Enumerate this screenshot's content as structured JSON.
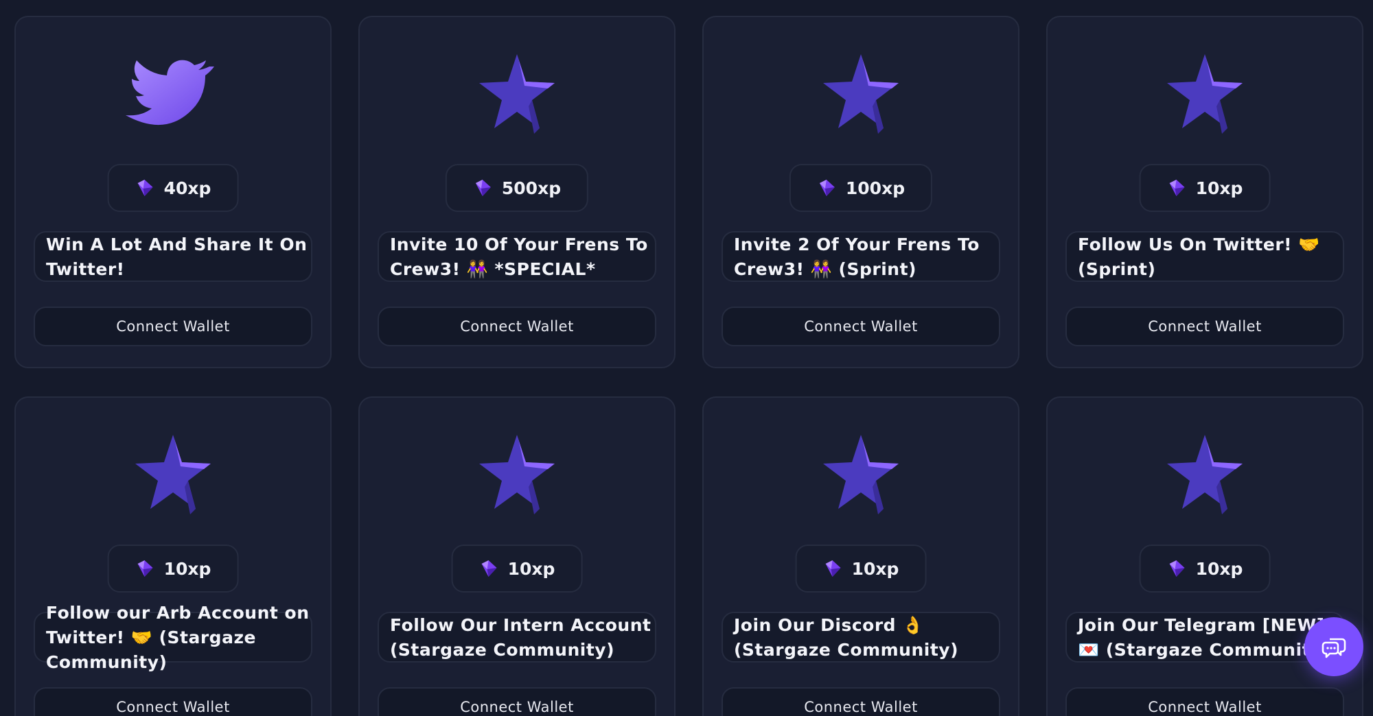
{
  "quests": [
    {
      "art": "twitter-bird",
      "xp": "40xp",
      "title": "Win A Lot And Share It On Twitter!",
      "button": "Connect Wallet"
    },
    {
      "art": "star",
      "xp": "500xp",
      "title": "Invite 10 Of Your Frens To Crew3! 👭 *SPECIAL*",
      "button": "Connect Wallet"
    },
    {
      "art": "star",
      "xp": "100xp",
      "title": "Invite 2 Of Your Frens To Crew3! 👭 (Sprint)",
      "button": "Connect Wallet"
    },
    {
      "art": "star",
      "xp": "10xp",
      "title": "Follow Us On Twitter! 🤝 (Sprint)",
      "button": "Connect Wallet"
    },
    {
      "art": "star",
      "xp": "10xp",
      "title": "Follow our Arb Account on Twitter! 🤝 (Stargaze Community)",
      "button": "Connect Wallet"
    },
    {
      "art": "star",
      "xp": "10xp",
      "title": "Follow Our Intern Account (Stargaze Community)",
      "button": "Connect Wallet"
    },
    {
      "art": "star",
      "xp": "10xp",
      "title": "Join Our Discord 👌 (Stargaze Community)",
      "button": "Connect Wallet"
    },
    {
      "art": "star",
      "xp": "10xp",
      "title": "Join Our Telegram [NEW] 💌 (Stargaze Community)",
      "button": "Connect Wallet"
    }
  ],
  "icons": {
    "xp": "gem-icon",
    "chat": "chat-bubbles-icon"
  },
  "colors": {
    "background": "#151a2b",
    "card": "#1a1f33",
    "border": "#262c40",
    "accent": "#7b4fff",
    "star": "#5b3fd0"
  }
}
